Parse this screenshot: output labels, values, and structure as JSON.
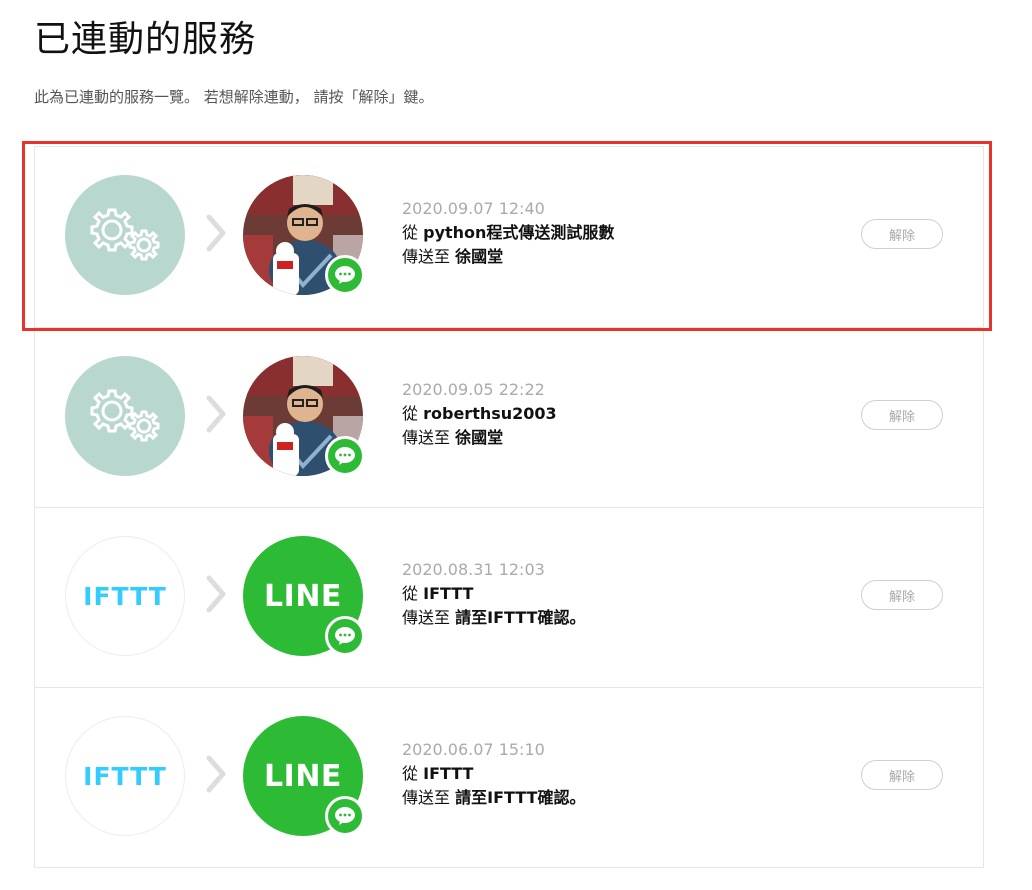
{
  "page": {
    "title": "已連動的服務",
    "description": "此為已連動的服務一覽。 若想解除連動， 請按「解除」鍵。"
  },
  "services": [
    {
      "source_icon": "gears-icon",
      "target_icon": "avatar-photo",
      "date": "2020.09.07 12:40",
      "from_prefix": "從",
      "from_name": "python程式傳送測試服數",
      "to_prefix": "傳送至",
      "to_name": "徐國堂",
      "unlink_label": "解除",
      "highlighted": true
    },
    {
      "source_icon": "gears-icon",
      "target_icon": "avatar-photo",
      "date": "2020.09.05 22:22",
      "from_prefix": "從",
      "from_name": "roberthsu2003",
      "to_prefix": "傳送至",
      "to_name": "徐國堂",
      "unlink_label": "解除"
    },
    {
      "source_icon": "ifttt-logo",
      "source_text": "IFTTT",
      "target_icon": "line-logo",
      "target_text": "LINE",
      "date": "2020.08.31 12:03",
      "from_prefix": "從",
      "from_name": "IFTTT",
      "to_prefix": "傳送至",
      "to_name": "請至IFTTT確認。",
      "unlink_label": "解除"
    },
    {
      "source_icon": "ifttt-logo",
      "source_text": "IFTTT",
      "target_icon": "line-logo",
      "target_text": "LINE",
      "date": "2020.06.07 15:10",
      "from_prefix": "從",
      "from_name": "IFTTT",
      "to_prefix": "傳送至",
      "to_name": "請至IFTTT確認。",
      "unlink_label": "解除"
    }
  ],
  "colors": {
    "gears_bg": "#b8d8cf",
    "line_green": "#2dbb35",
    "ifttt_blue": "#33ccff",
    "highlight_red": "#e8332a"
  }
}
